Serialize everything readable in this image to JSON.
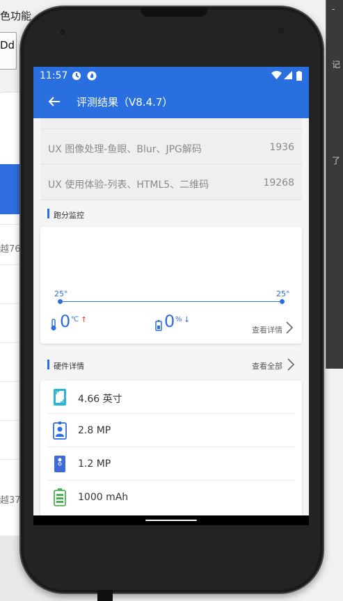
{
  "background": {
    "title": "色功能",
    "button_label": "Dd",
    "side_text_1": "越76",
    "side_text_2": "越37",
    "right_glyphs": [
      "-",
      "记",
      "了"
    ]
  },
  "status_bar": {
    "time": "11:57"
  },
  "app_bar": {
    "title": "评测结果（V8.4.7）"
  },
  "score_rows": [
    {
      "label": "UX 图像处理-鱼眼、Blur、JPG解码",
      "value": "1936"
    },
    {
      "label": "UX 使用体验-列表、HTML5、二维码",
      "value": "19268"
    }
  ],
  "monitor": {
    "section_title": "跑分监控",
    "start_temp": "25°",
    "end_temp": "25°",
    "temp_value": "0",
    "temp_unit": "℃",
    "temp_arrow": "↑",
    "battery_value": "0",
    "battery_unit": "%",
    "battery_arrow": "↓",
    "detail_link": "查看详情"
  },
  "hardware": {
    "section_title": "硬件详情",
    "view_all": "查看全部",
    "items": [
      {
        "icon": "screen-icon",
        "text": "4.66 英寸"
      },
      {
        "icon": "front-camera-icon",
        "text": "2.8 MP"
      },
      {
        "icon": "rear-camera-icon",
        "text": "1.2 MP"
      },
      {
        "icon": "battery-icon",
        "text": "1000 mAh"
      }
    ]
  },
  "colors": {
    "primary": "#2a6fe0",
    "red_arrow": "#e53935",
    "battery_green": "#4caf50"
  }
}
